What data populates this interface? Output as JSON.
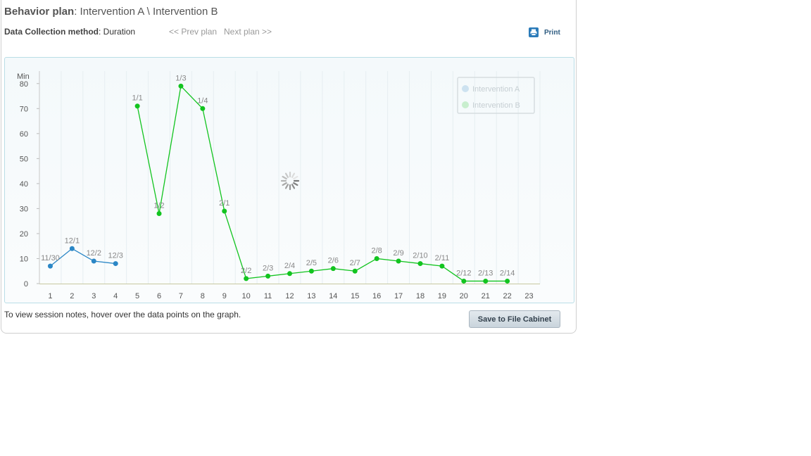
{
  "header": {
    "plan_label": "Behavior plan",
    "plan_name": ": Intervention A \\ Intervention B",
    "method_label": "Data Collection method",
    "method_value": ": Duration",
    "prev_plan": "<< Prev plan",
    "next_plan": "Next plan >>",
    "print_label": "Print"
  },
  "footer": {
    "hint": "To view session notes, hover over the data points on the graph.",
    "save_button": "Save to File Cabinet"
  },
  "colors": {
    "intervention_a": "#2b87c6",
    "intervention_b": "#12c41f",
    "grid": "#e6eef1",
    "axis_text": "#555555",
    "label_text": "#888888"
  },
  "icons": {
    "print": "printer-icon",
    "loading": "spinner-icon"
  },
  "chart_data": {
    "type": "line",
    "ylabel": "Min",
    "ylim": [
      0,
      85
    ],
    "yticks": [
      0,
      10,
      20,
      30,
      40,
      50,
      60,
      70,
      80
    ],
    "xlim": [
      0.5,
      23.5
    ],
    "xticks": [
      1,
      2,
      3,
      4,
      5,
      6,
      7,
      8,
      9,
      10,
      11,
      12,
      13,
      14,
      15,
      16,
      17,
      18,
      19,
      20,
      21,
      22,
      23
    ],
    "grid": true,
    "legend_position": "top-right",
    "series": [
      {
        "name": "Intervention A",
        "color_key": "intervention_a",
        "x": [
          1,
          2,
          3,
          4
        ],
        "y": [
          7,
          14,
          9,
          8
        ],
        "labels": [
          "11/30",
          "12/1",
          "12/2",
          "12/3"
        ]
      },
      {
        "name": "Intervention B",
        "color_key": "intervention_b",
        "x": [
          5,
          6,
          7,
          8,
          9,
          10,
          11,
          12,
          13,
          14,
          15,
          16,
          17,
          18,
          19,
          20,
          21,
          22
        ],
        "y": [
          71,
          28,
          79,
          70,
          29,
          2,
          3,
          4,
          5,
          6,
          5,
          10,
          9,
          8,
          7,
          1,
          1,
          1
        ],
        "labels": [
          "1/1",
          "1/2",
          "1/3",
          "1/4",
          "2/1",
          "2/2",
          "2/3",
          "2/4",
          "2/5",
          "2/6",
          "2/7",
          "2/8",
          "2/9",
          "2/10",
          "2/11",
          "2/12",
          "2/13",
          "2/14"
        ]
      }
    ]
  }
}
